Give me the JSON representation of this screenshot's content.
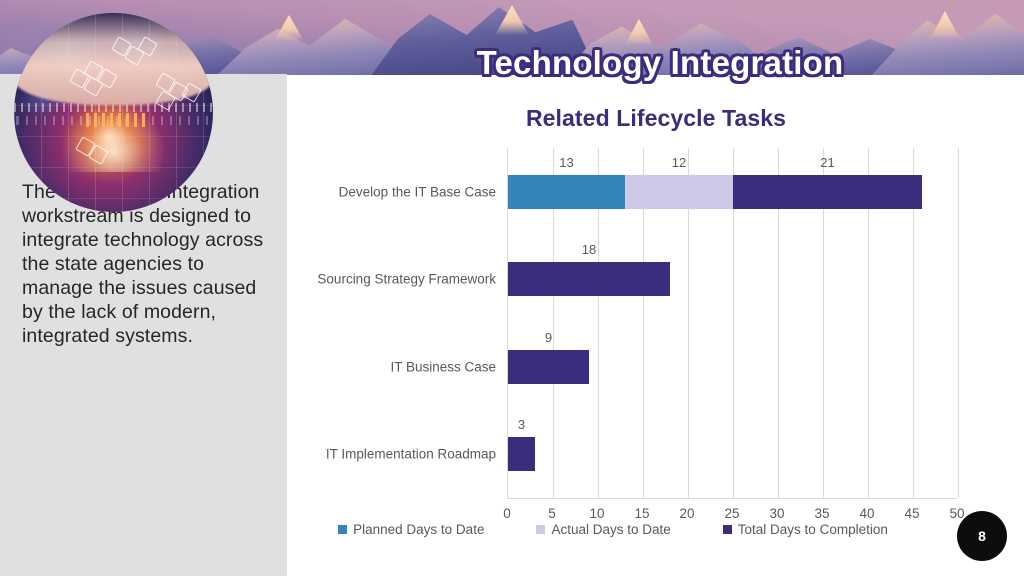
{
  "slide": {
    "title": "Technology Integration",
    "page_number": "8",
    "banner_image": "mountain-sunset-photo",
    "decorative_image": "technology-in-hands-circle-photo"
  },
  "left_panel": {
    "body_text": "The Technology Integration workstream is designed to integrate technology across the state agencies to manage the issues caused by the lack of modern, integrated systems."
  },
  "colors": {
    "title_outline": "#3b2c7e",
    "chart_title": "#3b2c7e",
    "planned": "#3584bc",
    "actual": "#cfc9e8",
    "total": "#3b2c7e",
    "panel_bg": "#e0e0e0",
    "axis_text": "#595959",
    "gridline": "#d9d9d9"
  },
  "chart_data": {
    "type": "bar",
    "orientation": "horizontal",
    "stacked": true,
    "title": "Related Lifecycle Tasks",
    "xlabel": "",
    "ylabel": "",
    "xlim": [
      0,
      50
    ],
    "xticks": [
      "0",
      "5",
      "10",
      "15",
      "20",
      "25",
      "30",
      "35",
      "40",
      "45",
      "50"
    ],
    "grid": true,
    "legend_position": "bottom",
    "categories": [
      "Develop the IT Base Case",
      "Sourcing Strategy Framework",
      "IT Business Case",
      "IT Implementation Roadmap"
    ],
    "series": [
      {
        "name": "Planned Days to Date",
        "color": "#3584bc",
        "values": [
          13,
          0,
          0,
          0
        ]
      },
      {
        "name": "Actual Days to Date",
        "color": "#cfc9e8",
        "values": [
          12,
          0,
          0,
          0
        ]
      },
      {
        "name": "Total Days to Completion",
        "color": "#3b2c7e",
        "values": [
          21,
          18,
          9,
          3
        ]
      }
    ],
    "data_labels": [
      [
        "13",
        "12",
        "21"
      ],
      [
        "18"
      ],
      [
        "9"
      ],
      [
        "3"
      ]
    ]
  }
}
